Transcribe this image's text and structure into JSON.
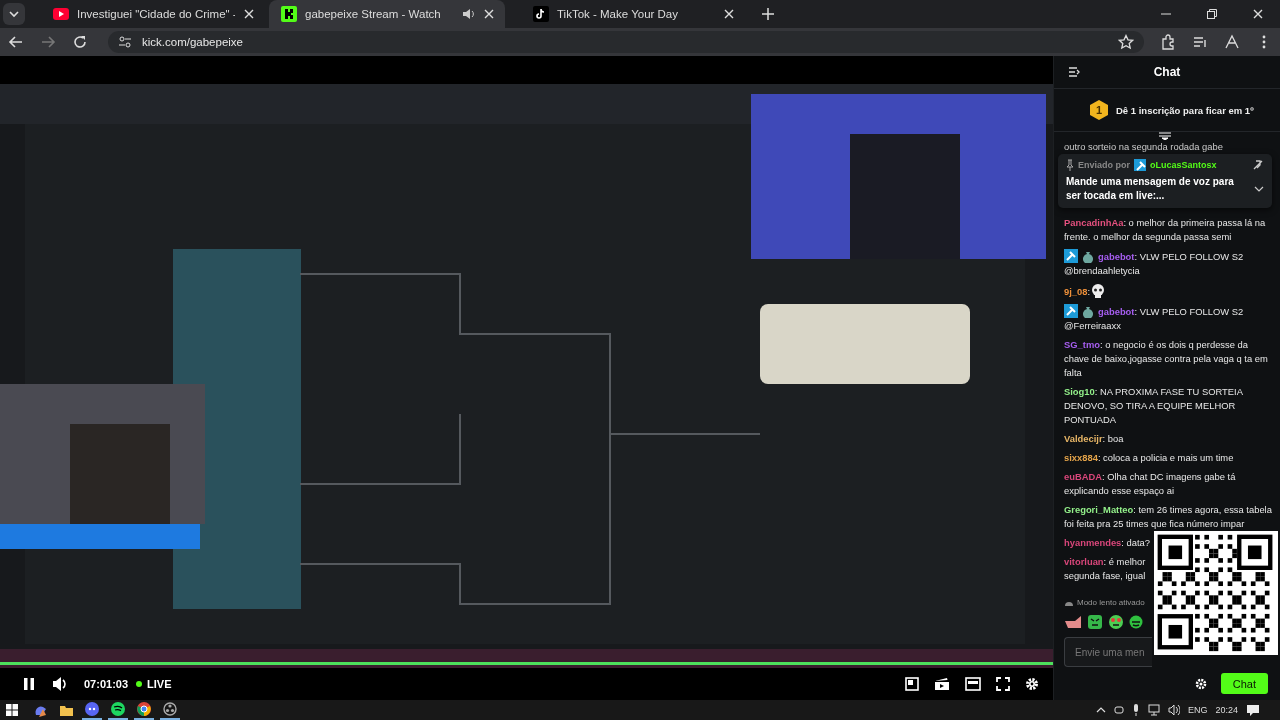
{
  "browser": {
    "tabs": [
      {
        "title": "Investiguei \"Cidade do Crime\" -",
        "selected": false,
        "audio": false
      },
      {
        "title": "gabepeixe Stream - Watch",
        "selected": true,
        "audio": true
      },
      {
        "title": "TikTok - Make Your Day",
        "selected": false,
        "audio": false
      }
    ],
    "address": "kick.com/gabepeixe"
  },
  "player": {
    "playing": true,
    "time": "07:01:03",
    "live": "LIVE"
  },
  "chat": {
    "title": "Chat",
    "subs_banner": {
      "rank": "1",
      "text": "Dê 1 inscrição para ficar em 1º"
    },
    "pinned": {
      "label": "Enviado por",
      "user": "oLucasSantosx",
      "color": "#53fc18",
      "text": "Mande uma mensagem de voz para ser tocada em live:..."
    },
    "messages": [
      {
        "kind": "fragment",
        "text": "outro sorteio na segunda rodada gabe"
      },
      {
        "kind": "text",
        "user": "PancadinhAa",
        "color": "#e4507e",
        "text": ": o melhor da primeira passa lá na frente. o melhor da segunda passa semi"
      },
      {
        "kind": "text",
        "user": "gabebot",
        "color": "#a65ef0",
        "badges": true,
        "text": ": VLW PELO FOLLOW S2 @brendaahletycia"
      },
      {
        "kind": "emote",
        "user": "9j_08",
        "color": "#f0913a",
        "text": ":"
      },
      {
        "kind": "text",
        "user": "gabebot",
        "color": "#a65ef0",
        "badges": true,
        "text": ": VLW PELO FOLLOW S2 @Ferreiraaxx"
      },
      {
        "kind": "text",
        "user": "SG_tmo",
        "color": "#a65ef0",
        "text": ": o negocio é os dois q perdesse da chave de baixo,jogasse contra pela vaga q ta em falta"
      },
      {
        "kind": "text",
        "user": "Siog10",
        "color": "#93f08a",
        "text": ": NA PROXIMA FASE TU SORTEIA DENOVO, SO TIRA A EQUIPE MELHOR PONTUADA"
      },
      {
        "kind": "text",
        "user": "Valdecijr",
        "color": "#e6b566",
        "text": ": boa"
      },
      {
        "kind": "text",
        "user": "sixx884",
        "color": "#e6a54a",
        "text": ": coloca a policia e mais um time"
      },
      {
        "kind": "text",
        "user": "euBADA",
        "color": "#d9467a",
        "text": ": Olha chat DC imagens gabe tá explicando esse espaço ai"
      },
      {
        "kind": "text",
        "user": "Gregori_Matteo",
        "color": "#93f08a",
        "text": ": tem 26 times agora, essa tabela foi feita pra 25 times que fica número impar"
      },
      {
        "kind": "text",
        "user": "hyanmendes",
        "color": "#d9467a",
        "text": ": data?"
      },
      {
        "kind": "text",
        "user": "vitorluan",
        "color": "#d9467a",
        "text": ": é melhor segunda fase, igual"
      }
    ],
    "slow_mode": "Modo lento ativado",
    "input": {
      "placeholder": "Envie uma men"
    },
    "send": "Chat"
  },
  "taskbar": {
    "apps": [
      {
        "running": false
      },
      {
        "running": false
      },
      {
        "running": true
      },
      {
        "running": true
      },
      {
        "running": true
      },
      {
        "running": true
      }
    ],
    "language": "ENG",
    "clock": "20:24"
  }
}
